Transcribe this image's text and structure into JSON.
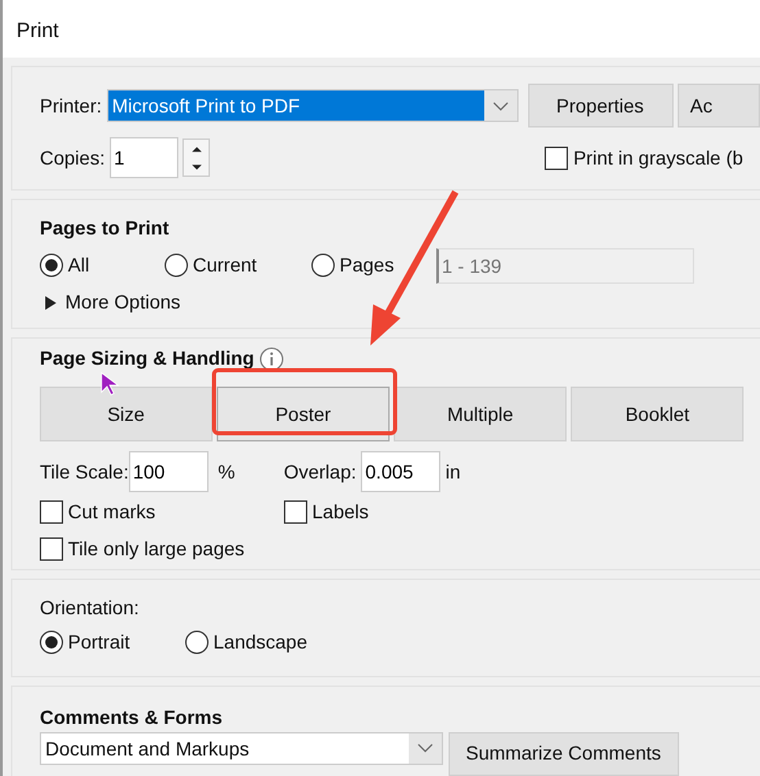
{
  "window": {
    "title": "Print"
  },
  "printer": {
    "label": "Printer:",
    "value": "Microsoft Print to PDF",
    "buttons": [
      "Properties",
      "Ac"
    ],
    "copies_label": "Copies:",
    "copies": "1",
    "grayscale": {
      "label": "Print in grayscale (b",
      "checked": false
    }
  },
  "pages_to_print": {
    "title": "Pages to Print",
    "options": [
      {
        "label": "All",
        "selected": true
      },
      {
        "label": "Current",
        "selected": false
      },
      {
        "label": "Pages",
        "selected": false
      }
    ],
    "range_placeholder": "1 - 139",
    "more_options": "More Options",
    "expanded": false
  },
  "page_sizing": {
    "title": "Page Sizing & Handling",
    "modes": [
      {
        "label": "Size",
        "selected": false
      },
      {
        "label": "Poster",
        "selected": true
      },
      {
        "label": "Multiple",
        "selected": false
      },
      {
        "label": "Booklet",
        "selected": false
      }
    ],
    "tile_scale": {
      "label": "Tile Scale:",
      "value": "100",
      "unit": "%"
    },
    "overlap": {
      "label": "Overlap:",
      "value": "0.005",
      "unit": "in"
    },
    "checkboxes": [
      {
        "label": "Cut marks",
        "checked": false
      },
      {
        "label": "Labels",
        "checked": false
      },
      {
        "label": "Tile only large pages",
        "checked": false
      }
    ]
  },
  "orientation": {
    "title": "Orientation:",
    "options": [
      {
        "label": "Portrait",
        "selected": true
      },
      {
        "label": "Landscape",
        "selected": false
      }
    ]
  },
  "comments_forms": {
    "title": "Comments & Forms",
    "value": "Document and Markups",
    "button": "Summarize Comments"
  }
}
